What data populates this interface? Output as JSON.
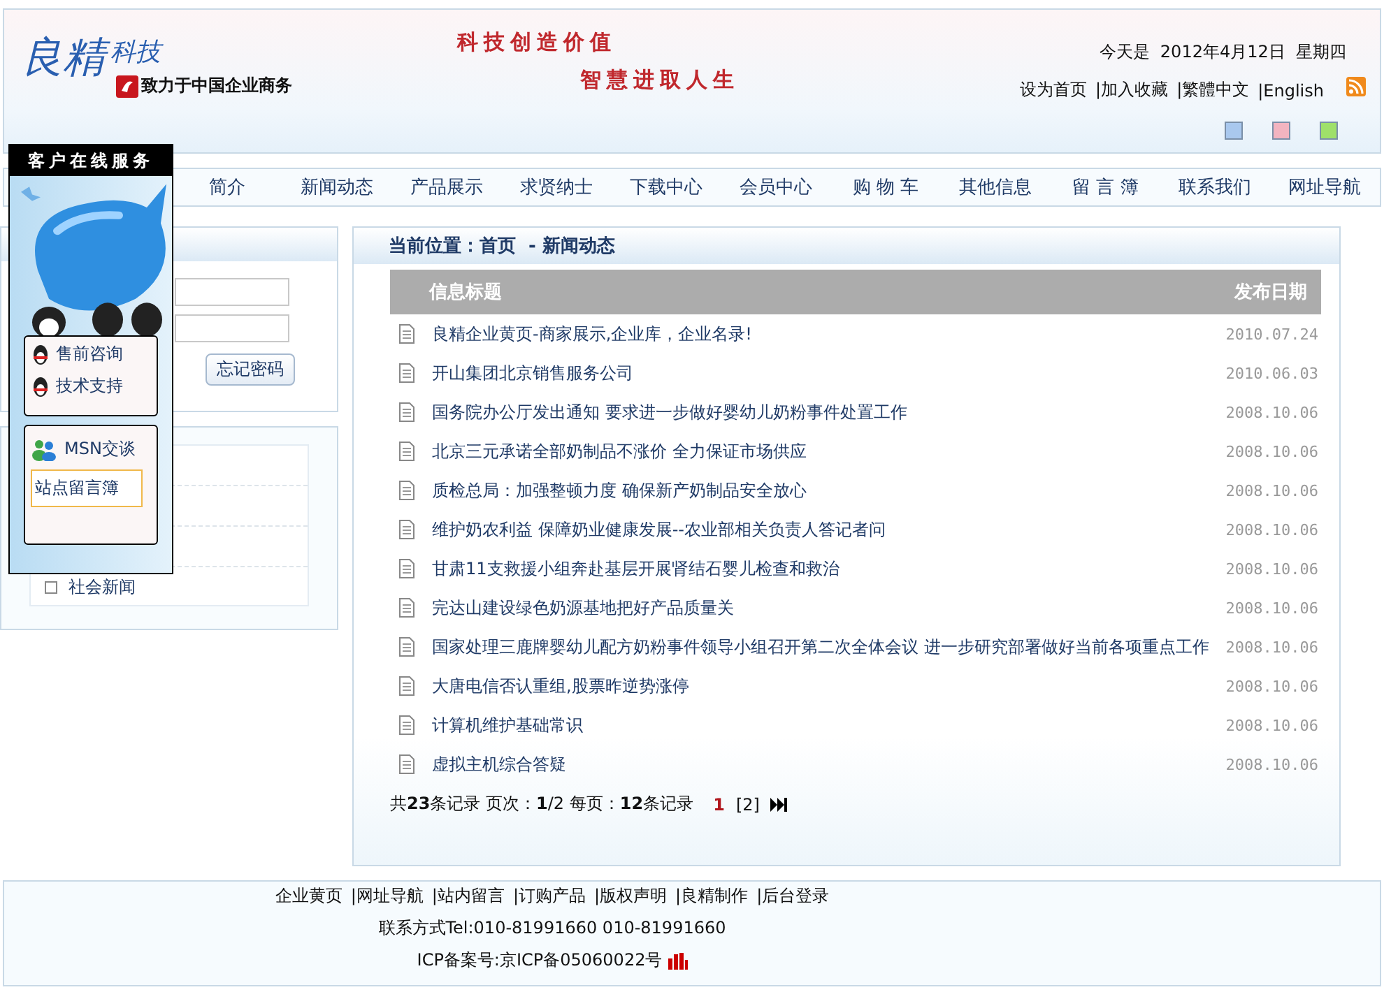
{
  "header": {
    "logo": {
      "name": "良精",
      "sub": "科技",
      "tagline": "致力于中国企业商务"
    },
    "slogans": [
      "科技创造价值",
      "智慧进取人生"
    ],
    "date": "今天是  2012年4月12日  星期四",
    "links": [
      "设为首页",
      "|加入收藏",
      "|繁體中文",
      "|English"
    ],
    "themes": [
      {
        "color": "#a9c8ee",
        "selected": false
      },
      {
        "color": "#f2b4c0",
        "selected": false
      },
      {
        "color": "#9fe06a",
        "selected": false
      }
    ]
  },
  "nav": [
    "简介",
    "新闻动态",
    "产品展示",
    "求贤纳士",
    "下载中心",
    "会员中心",
    "购 物 车",
    "其他信息",
    "留 言 簿",
    "联系我们",
    "网址导航"
  ],
  "login": {
    "buttons": [
      "忘记密码"
    ]
  },
  "categories": [
    "社会新闻"
  ],
  "service_panel": {
    "title": "客户在线服务",
    "qq": [
      "售前咨询",
      "技术支持"
    ],
    "msn": "MSN交谈",
    "guestbook": "站点留言簿"
  },
  "breadcrumb": "当前位置：首页  - 新闻动态",
  "table": {
    "columns": [
      "信息标题",
      "发布日期"
    ],
    "rows": [
      {
        "title": "良精企业黄页-商家展示,企业库，企业名录!",
        "date": "2010.07.24"
      },
      {
        "title": "开山集团北京销售服务公司",
        "date": "2010.06.03"
      },
      {
        "title": "国务院办公厅发出通知 要求进一步做好婴幼儿奶粉事件处置工作",
        "date": "2008.10.06"
      },
      {
        "title": "北京三元承诺全部奶制品不涨价 全力保证市场供应",
        "date": "2008.10.06"
      },
      {
        "title": "质检总局：加强整顿力度 确保新产奶制品安全放心",
        "date": "2008.10.06"
      },
      {
        "title": "维护奶农利益 保障奶业健康发展--农业部相关负责人答记者问",
        "date": "2008.10.06"
      },
      {
        "title": "甘肃11支救援小组奔赴基层开展肾结石婴儿检查和救治",
        "date": "2008.10.06"
      },
      {
        "title": "完达山建设绿色奶源基地把好产品质量关",
        "date": "2008.10.06"
      },
      {
        "title": "国家处理三鹿牌婴幼儿配方奶粉事件领导小组召开第二次全体会议 进一步研究部署做好当前各项重点工作",
        "date": "2008.10.06"
      },
      {
        "title": "大唐电信否认重组,股票昨逆势涨停",
        "date": "2008.10.06"
      },
      {
        "title": "计算机维护基础常识",
        "date": "2008.10.06"
      },
      {
        "title": "虚拟主机综合答疑",
        "date": "2008.10.06"
      }
    ]
  },
  "pagination": {
    "summary": "共**23**条记录 页次：**1**/2 每页：**12**条记录",
    "pages": [
      {
        "label": "1",
        "selected": true
      },
      {
        "label": "[2]",
        "selected": false
      }
    ]
  },
  "footer": {
    "links": [
      "企业黄页",
      "|网址导航",
      "|站内留言",
      "|订购产品",
      "|版权声明",
      "|良精制作",
      "|后台登录"
    ],
    "contact": "联系方式Tel:010-81991660 010-81991660",
    "icp": "ICP备案号:京ICP备05060022号"
  }
}
